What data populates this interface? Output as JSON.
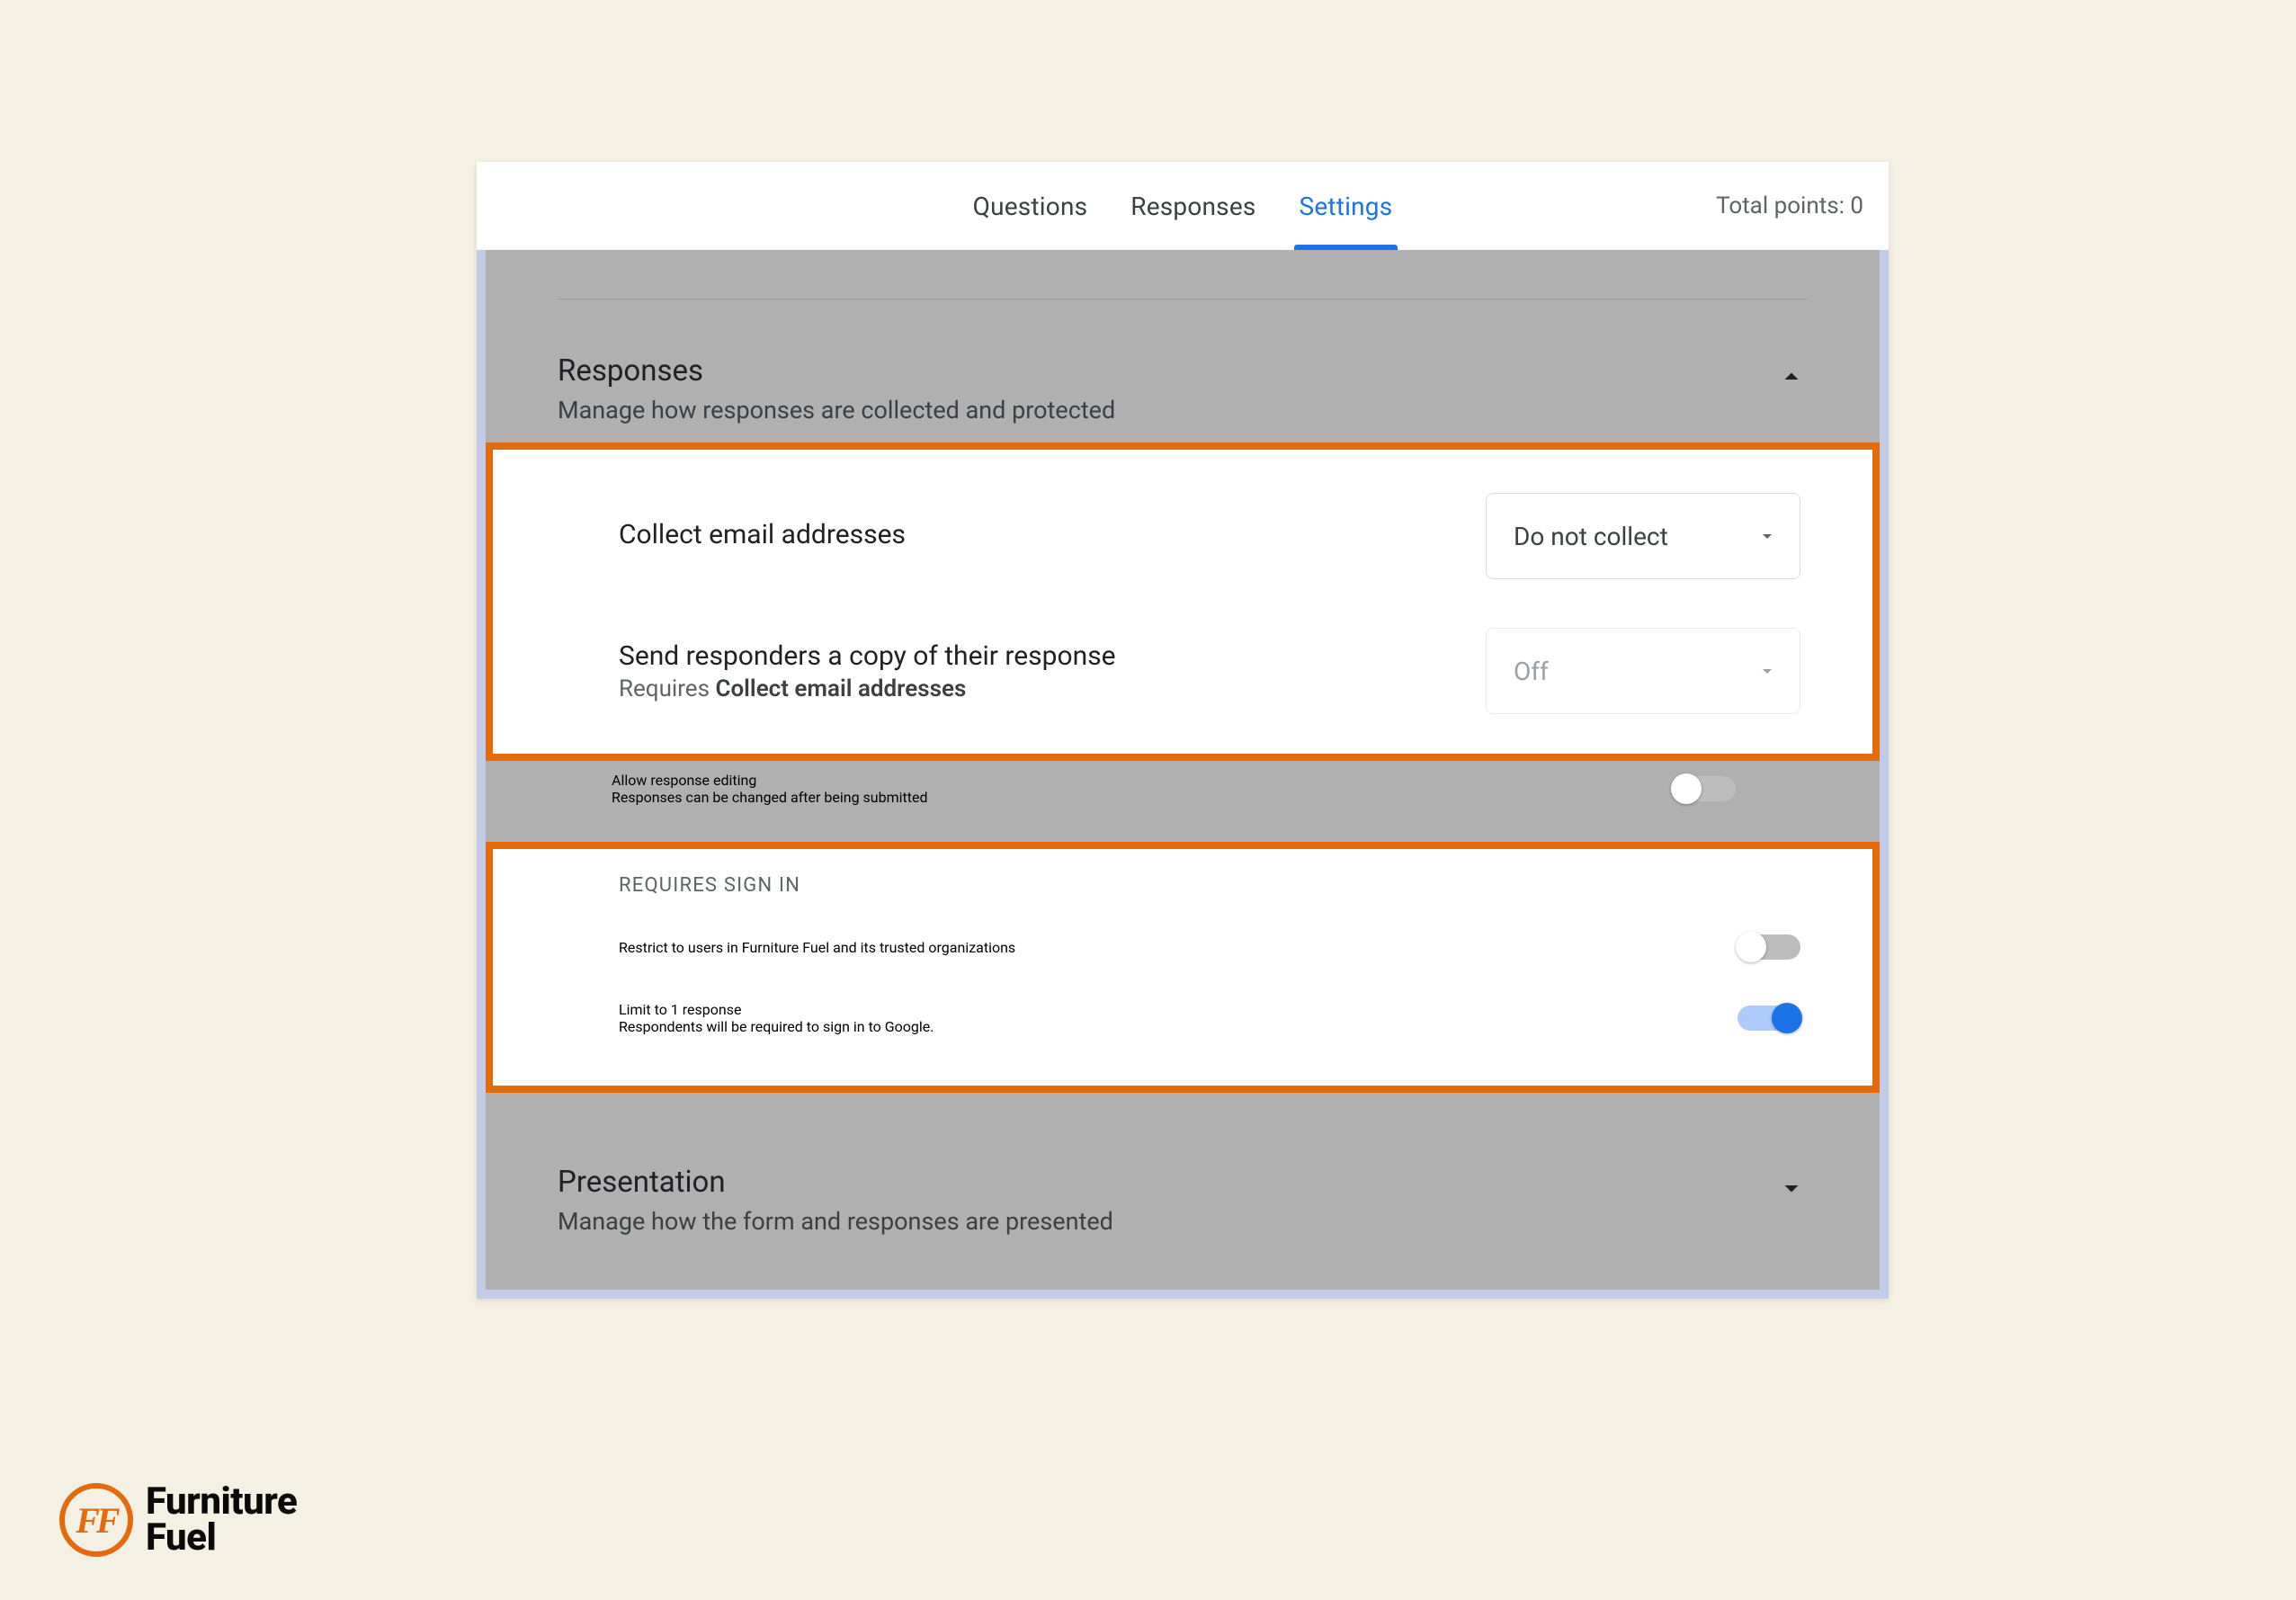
{
  "tabs": {
    "questions": "Questions",
    "responses": "Responses",
    "settings": "Settings"
  },
  "total_points": "Total points: 0",
  "responses_section": {
    "title": "Responses",
    "subtitle": "Manage how responses are collected and protected"
  },
  "collect_email": {
    "label": "Collect email addresses",
    "value": "Do not collect"
  },
  "send_copy": {
    "label": "Send responders a copy of their response",
    "requires_prefix": "Requires ",
    "requires_bold": "Collect email addresses",
    "value": "Off"
  },
  "allow_edit": {
    "label": "Allow response editing",
    "sub": "Responses can be changed after being submitted"
  },
  "signin_header": "REQUIRES SIGN IN",
  "restrict": {
    "label": "Restrict to users in Furniture Fuel and its trusted organizations"
  },
  "limit": {
    "label": "Limit to 1 response",
    "sub": "Respondents will be required to sign in to Google."
  },
  "presentation": {
    "title": "Presentation",
    "subtitle": "Manage how the form and responses are presented"
  },
  "brand": {
    "name_line1": "Furniture",
    "name_line2": "Fuel",
    "badge": "FF"
  }
}
